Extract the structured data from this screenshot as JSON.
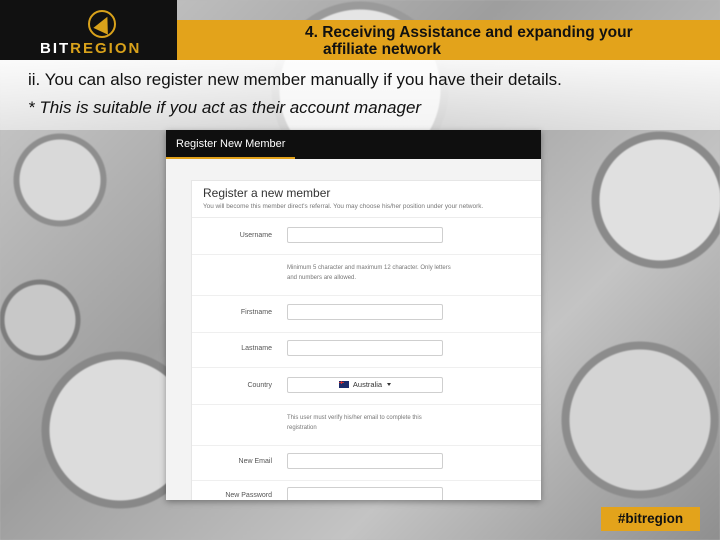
{
  "brand": {
    "logo_text_a": "BIT",
    "logo_text_b": "REGION",
    "accent_color": "#e3a31b",
    "icon": "bitregion-logo-icon"
  },
  "slide": {
    "title_line1": "4. Receiving Assistance and expanding your",
    "title_line2": "affiliate network",
    "line1": "ii. You can also register new member manually if you have their details.",
    "line2": "* This is suitable if you act as their account manager",
    "hashtag": "#bitregion"
  },
  "screenshot": {
    "tab_label": "Register New Member",
    "card_title": "Register a new member",
    "card_subtitle": "You will become this member direct's referral. You may choose his/her position under your network.",
    "fields": {
      "username_label": "Username",
      "username_value": "",
      "username_help": "Minimum 5 character and maximum 12 character. Only letters and numbers are allowed.",
      "firstname_label": "Firstname",
      "firstname_value": "",
      "lastname_label": "Lastname",
      "lastname_value": "",
      "country_label": "Country",
      "country_value": "Australia",
      "email_help": "This user must verify his/her email to complete this registration",
      "email_label": "New Email",
      "email_value": "",
      "password_label": "New Password",
      "password_value": ""
    }
  }
}
